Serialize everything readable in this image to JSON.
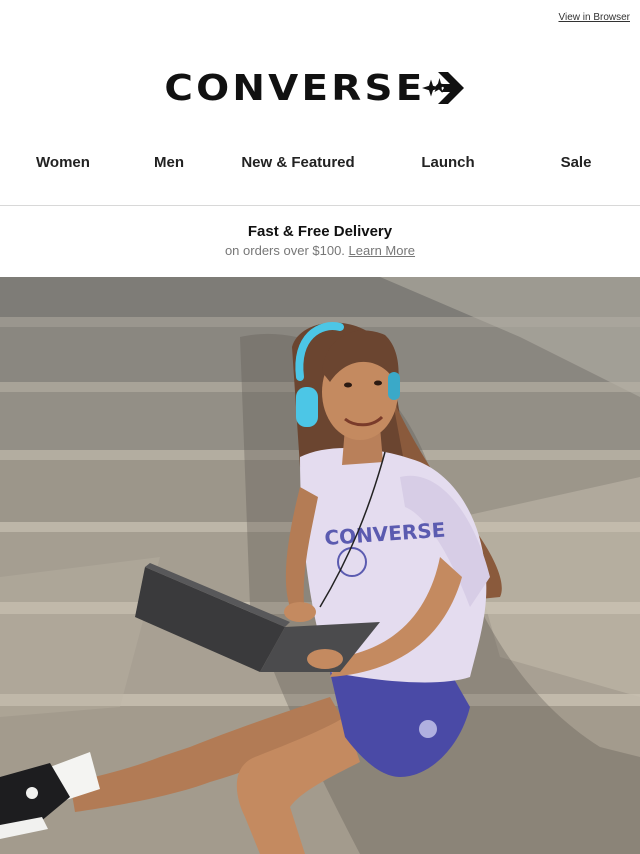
{
  "header": {
    "view_in_browser": "View in Browser",
    "brand": "CONVERSE"
  },
  "nav": {
    "items": [
      {
        "label": "Women"
      },
      {
        "label": "Men"
      },
      {
        "label": "New & Featured"
      },
      {
        "label": "Launch"
      },
      {
        "label": "Sale"
      }
    ]
  },
  "promo": {
    "title": "Fast & Free Delivery",
    "subtitle": "on orders over $100.",
    "link": "Learn More"
  },
  "hero": {
    "shirt_text": "CONVERSE"
  },
  "colors": {
    "text": "#111111",
    "muted": "#777777",
    "divider": "#d8d8d8",
    "headphone": "#4cc6e6",
    "shirt": "#e4dcef",
    "shorts": "#4a4aa6"
  }
}
